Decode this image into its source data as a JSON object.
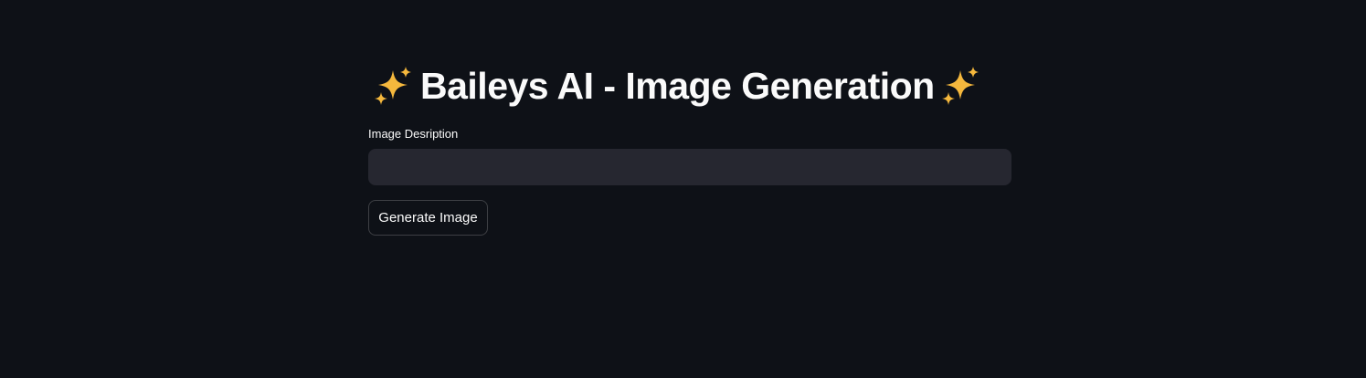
{
  "header": {
    "title": "Baileys AI - Image Generation",
    "leading_icon": "sparkles-icon",
    "trailing_icon": "sparkles-icon"
  },
  "form": {
    "description_label": "Image Desription",
    "description_value": "",
    "description_placeholder": "",
    "generate_button_label": "Generate Image"
  },
  "colors": {
    "background": "#0e1117",
    "input_background": "#262730",
    "text": "#fafafa",
    "sparkle": "#f5b83d"
  }
}
